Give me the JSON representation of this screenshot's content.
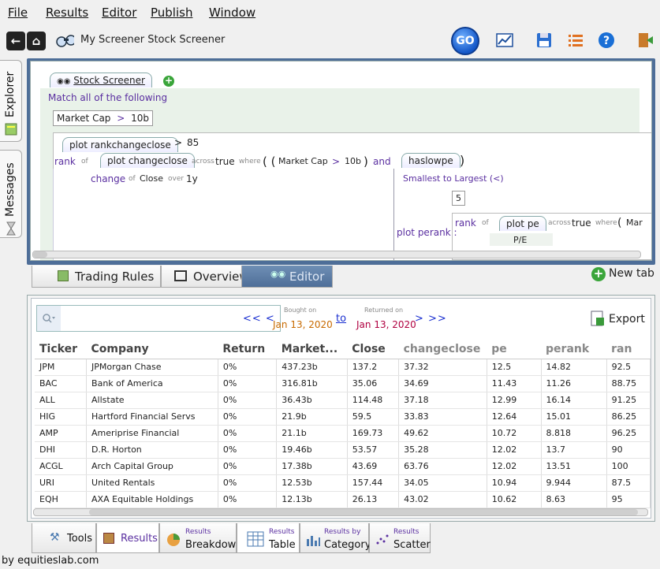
{
  "menu": [
    "File",
    "Results",
    "Editor",
    "Publish",
    "Window"
  ],
  "toolbar": {
    "title": "My Screener Stock Screener",
    "go_label": "GO"
  },
  "side_tabs": [
    "Explorer",
    "Messages"
  ],
  "editor": {
    "tab_label": "Stock Screener",
    "match_text": "Match all of the following",
    "rule1": {
      "field": "Market Cap",
      "op": ">",
      "value": "10b"
    },
    "plot_rankchangeclose": "plot rankchangeclose",
    "gt": ">",
    "threshold": "85",
    "rank": "rank",
    "of": "of",
    "plot_changeclose": "plot changeclose",
    "across": "across",
    "true": "true",
    "where": "where",
    "paren_open": "( (",
    "cond_field": "Market Cap",
    "cond_op": ">",
    "cond_value": "10b",
    "paren_close1": ")",
    "and": "and",
    "haslowpe": "haslowpe",
    "paren_close2": ")",
    "change": "change",
    "close": "Close",
    "over": "over",
    "period": "1y",
    "sort_order": "Smallest to Largest (<)",
    "count": "5",
    "plot_perank": "plot perank :",
    "rank2": "rank",
    "of2": "of",
    "plot_pe": "plot pe",
    "pe_sub": "P/E",
    "across2": "across",
    "true2": "true",
    "where2": "where",
    "paren3": "(",
    "mar": "Mar"
  },
  "editor_tabs": [
    "Trading Rules",
    "Overview",
    "Editor"
  ],
  "new_tab_label": "New tab",
  "results": {
    "nav_back": "<< <",
    "bought_on_label": "Bought on",
    "bought_on": "Jan 13, 2020",
    "to": "to",
    "returned_on_label": "Returned on",
    "returned_on": "Jan 13, 2020",
    "nav_fwd": "> >>",
    "export": "Export",
    "columns": [
      "Ticker",
      "Company",
      "Return",
      "Market...",
      "Close",
      "changeclose",
      "pe",
      "perank",
      "ran"
    ],
    "rows": [
      [
        "JPM",
        "JPMorgan Chase",
        "0%",
        "437.23b",
        "137.2",
        "37.32",
        "12.5",
        "14.82",
        "92.5"
      ],
      [
        "BAC",
        "Bank of America",
        "0%",
        "316.81b",
        "35.06",
        "34.69",
        "11.43",
        "11.26",
        "88.75"
      ],
      [
        "ALL",
        "Allstate",
        "0%",
        "36.43b",
        "114.48",
        "37.18",
        "12.99",
        "16.14",
        "91.25"
      ],
      [
        "HIG",
        "Hartford Financial Servs",
        "0%",
        "21.9b",
        "59.5",
        "33.83",
        "12.64",
        "15.01",
        "86.25"
      ],
      [
        "AMP",
        "Ameriprise Financial",
        "0%",
        "21.1b",
        "169.73",
        "49.62",
        "10.72",
        "8.818",
        "96.25"
      ],
      [
        "DHI",
        "D.R. Horton",
        "0%",
        "19.46b",
        "53.57",
        "35.28",
        "12.02",
        "13.7",
        "90"
      ],
      [
        "ACGL",
        "Arch Capital Group",
        "0%",
        "17.38b",
        "43.69",
        "63.76",
        "12.02",
        "13.51",
        "100"
      ],
      [
        "URI",
        "United Rentals",
        "0%",
        "12.53b",
        "157.44",
        "34.05",
        "10.94",
        "9.944",
        "87.5"
      ],
      [
        "EQH",
        "AXA Equitable Holdings",
        "0%",
        "12.13b",
        "26.13",
        "43.02",
        "10.62",
        "8.63",
        "95"
      ]
    ]
  },
  "result_tabs": [
    {
      "small": "",
      "label": "Tools"
    },
    {
      "small": "",
      "label": "Results"
    },
    {
      "small": "Results",
      "label": "Breakdown"
    },
    {
      "small": "Results",
      "label": "Table"
    },
    {
      "small": "Results by",
      "label": "Category"
    },
    {
      "small": "Results",
      "label": "Scatter"
    }
  ],
  "footer": "by equitieslab.com",
  "colors": {
    "accent": "#4e6e98",
    "kw": "#5a2fa0",
    "date": "#c86a00",
    "link": "#1a2fd0"
  }
}
